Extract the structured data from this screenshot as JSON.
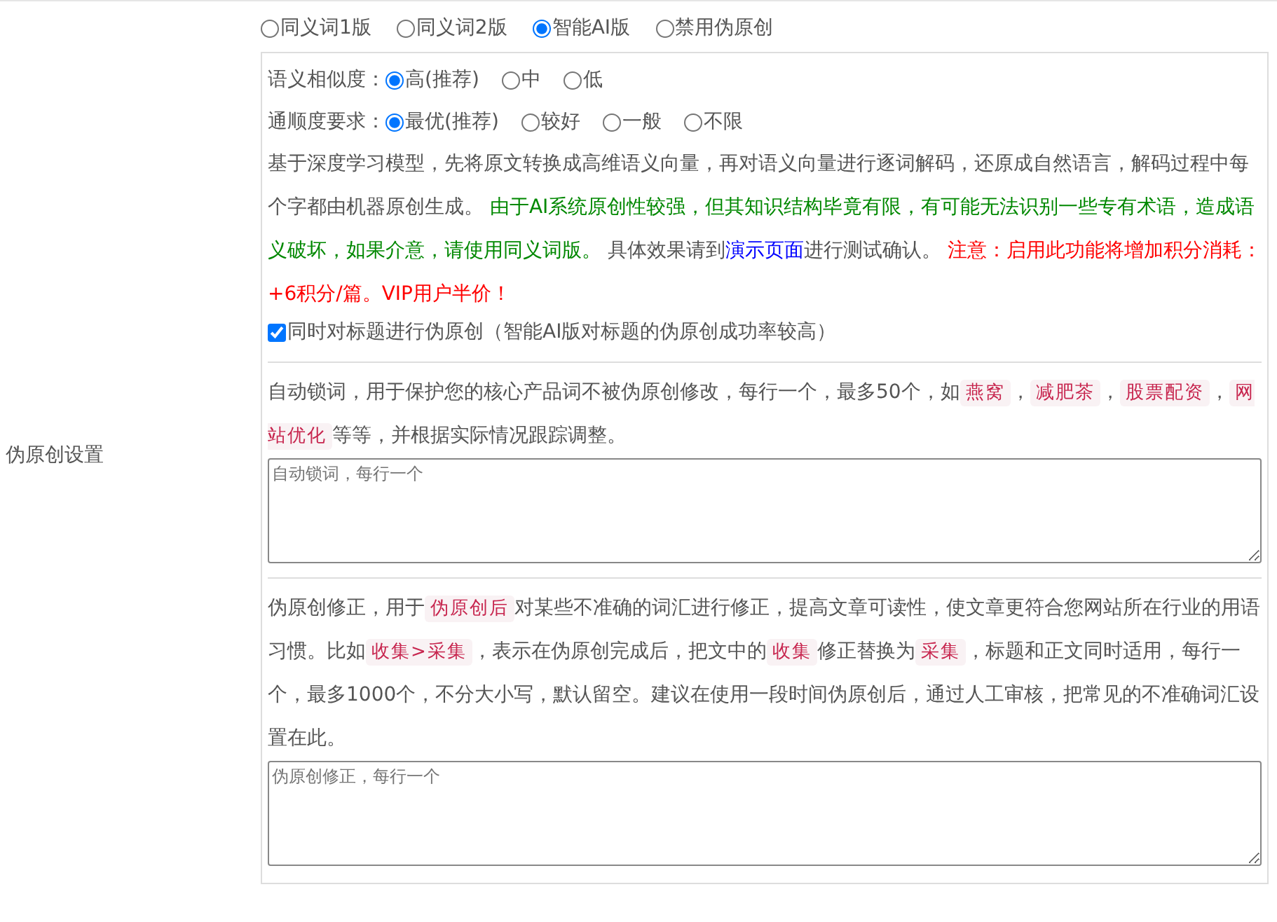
{
  "section_label": "伪原创设置",
  "modes": [
    {
      "label": "同义词1版",
      "selected": false
    },
    {
      "label": "同义词2版",
      "selected": false
    },
    {
      "label": "智能AI版",
      "selected": true
    },
    {
      "label": "禁用伪原创",
      "selected": false
    }
  ],
  "settings": [
    {
      "label": "语义相似度：",
      "options": [
        {
          "label": "高(推荐)",
          "selected": true
        },
        {
          "label": "中",
          "selected": false
        },
        {
          "label": "低",
          "selected": false
        }
      ]
    },
    {
      "label": "通顺度要求：",
      "options": [
        {
          "label": "最优(推荐)",
          "selected": true
        },
        {
          "label": "较好",
          "selected": false
        },
        {
          "label": "一般",
          "selected": false
        },
        {
          "label": "不限",
          "selected": false
        }
      ]
    }
  ],
  "ai_description": [
    {
      "kind": "plain",
      "text": "基于深度学习模型，先将原文转换成高维语义向量，再对语义向量进行逐词解码，还原成自然语言，解码过程中每个字都由机器原创生成。 "
    },
    {
      "kind": "note",
      "text": "由于AI系统原创性较强，但其知识结构毕竟有限，有可能无法识别一些专有术语，造成语义破坏，如果介意，请使用同义词版。"
    },
    {
      "kind": "plain",
      "text": " 具体效果请到"
    },
    {
      "kind": "link",
      "text": "演示页面"
    },
    {
      "kind": "plain",
      "text": "进行测试确认。 "
    },
    {
      "kind": "warning",
      "text": "注意：启用此功能将增加积分消耗：+6积分/篇。VIP用户半价！"
    }
  ],
  "title_option": {
    "label": "同时对标题进行伪原创（智能AI版对标题的伪原创成功率较高）",
    "checked": true
  },
  "lock_words": {
    "description": [
      {
        "kind": "plain",
        "text": "自动锁词，用于保护您的核心产品词不被伪原创修改，每行一个，最多50个，如"
      },
      {
        "kind": "code",
        "text": "燕窝"
      },
      {
        "kind": "plain",
        "text": "，"
      },
      {
        "kind": "code",
        "text": "减肥茶"
      },
      {
        "kind": "plain",
        "text": "，"
      },
      {
        "kind": "code",
        "text": "股票配资"
      },
      {
        "kind": "plain",
        "text": "，"
      },
      {
        "kind": "code",
        "text": "网站优化"
      },
      {
        "kind": "plain",
        "text": "等等，并根据实际情况跟踪调整。"
      }
    ],
    "placeholder": "自动锁词，每行一个"
  },
  "corrections": {
    "description": [
      {
        "kind": "plain",
        "text": "伪原创修正，用于"
      },
      {
        "kind": "code",
        "text": "伪原创后"
      },
      {
        "kind": "plain",
        "text": "对某些不准确的词汇进行修正，提高文章可读性，使文章更符合您网站所在行业的用语习惯。比如"
      },
      {
        "kind": "code",
        "text": "收集>采集"
      },
      {
        "kind": "plain",
        "text": "，表示在伪原创完成后，把文中的"
      },
      {
        "kind": "code",
        "text": "收集"
      },
      {
        "kind": "plain",
        "text": "修正替换为"
      },
      {
        "kind": "code",
        "text": "采集"
      },
      {
        "kind": "plain",
        "text": "，标题和正文同时适用，每行一个，最多1000个，不分大小写，默认留空。建议在使用一段时间伪原创后，通过人工审核，把常见的不准确词汇设置在此。"
      }
    ],
    "placeholder": "伪原创修正，每行一个"
  }
}
